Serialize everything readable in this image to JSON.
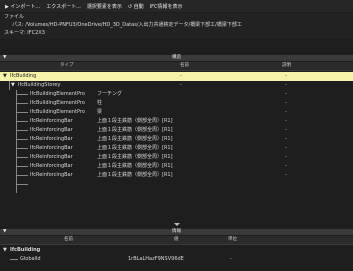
{
  "toolbar": {
    "items": [
      "▶ インポート...",
      "エクスポート...",
      "選択要素を表示",
      "↺ 自動",
      "IFC情報を表示"
    ]
  },
  "info": {
    "file_label": "ファイル",
    "path_label": "パス:",
    "path_value": "/Volumes/HD-PNFU3/OneDrive/HD_3D_Datas/入出力共通検定データ/橋梁下部工/橋梁下部工",
    "schema_label": "スキーマ:",
    "schema_value": "IFC2X3"
  },
  "structure_panel": {
    "title": "構造",
    "caret": "▼",
    "columns": {
      "type": "タイプ",
      "name": "名前",
      "desc": "説明"
    },
    "rows": [
      {
        "type": "IfcBuilding",
        "name": "-",
        "desc": "-",
        "selected": true,
        "toggle": "▼"
      },
      {
        "type": "IfcBuildingStorey",
        "name": "-",
        "desc": "-",
        "toggle": "▼"
      },
      {
        "type": "IfcBuildingElementPro",
        "name": "フーチング",
        "desc": "-"
      },
      {
        "type": "IfcBuildingElementPro",
        "name": "柱",
        "desc": "-"
      },
      {
        "type": "IfcBuildingElementPro",
        "name": "梁",
        "desc": "-"
      },
      {
        "type": "IfcReinforcingBar",
        "name": "上面１段主鉄筋（側部全周）[R1]",
        "desc": "-"
      },
      {
        "type": "IfcReinforcingBar",
        "name": "上面１段主鉄筋（側部全周）[R1]",
        "desc": "-"
      },
      {
        "type": "IfcReinforcingBar",
        "name": "上面１段主鉄筋（側部全周）[R1]",
        "desc": "-"
      },
      {
        "type": "IfcReinforcingBar",
        "name": "上面１段主鉄筋（側部全周）[R1]",
        "desc": "-"
      },
      {
        "type": "IfcReinforcingBar",
        "name": "上面１段主鉄筋（側部全周）[R1]",
        "desc": "-"
      },
      {
        "type": "IfcReinforcingBar",
        "name": "上面１段主鉄筋（側部全周）[R1]",
        "desc": "-"
      },
      {
        "type": "IfcReinforcingBar",
        "name": "上面１段主鉄筋（側部全周）[R1]",
        "desc": "-"
      }
    ]
  },
  "info_panel": {
    "title": "情報",
    "caret": "▼",
    "columns": {
      "name": "名前",
      "value": "値",
      "unit": "単位"
    },
    "rows": [
      {
        "name": "IfcBuilding",
        "value": "",
        "unit": "",
        "toggle": "▼",
        "bold": true
      },
      {
        "name": "GlobalId",
        "value": "1rBLaLHazF9NSV96dE",
        "unit": "-"
      }
    ]
  },
  "colors": {
    "selected_row": "#f6f3a8",
    "background": "#1e1e1e"
  }
}
